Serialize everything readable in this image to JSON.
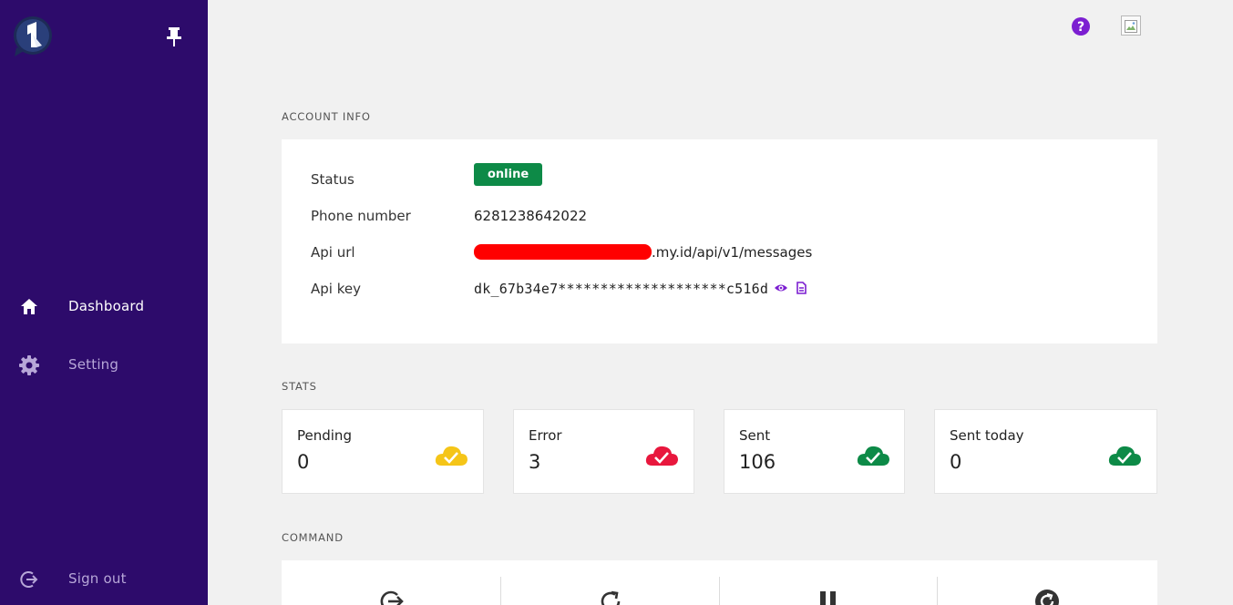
{
  "sidebar": {
    "items": [
      {
        "label": "Dashboard",
        "icon": "home-icon"
      },
      {
        "label": "Setting",
        "icon": "gear-icon"
      }
    ],
    "signout_label": "Sign out",
    "colors": {
      "background": "#2d0b6b",
      "active_text": "#ffffff",
      "inactive_text": "#b7a7d8"
    }
  },
  "header": {
    "help_icon": "help-icon",
    "avatar": "broken-image-icon"
  },
  "sections": {
    "account_info": "ACCOUNT INFO",
    "stats": "STATS",
    "command": "COMMAND"
  },
  "account": {
    "status_label": "Status",
    "status_value": "online",
    "phone_label": "Phone number",
    "phone_value": "6281238642022",
    "api_url_label": "Api url",
    "api_url_suffix": ".my.id/api/v1/messages",
    "api_key_label": "Api key",
    "api_key_value": "dk_67b34e7********************c516d"
  },
  "stats": [
    {
      "label": "Pending",
      "value": "0",
      "color": "#f5c518"
    },
    {
      "label": "Error",
      "value": "3",
      "color": "#e8173d"
    },
    {
      "label": "Sent",
      "value": "106",
      "color": "#0d8a47"
    },
    {
      "label": "Sent today",
      "value": "0",
      "color": "#0d8a47"
    }
  ],
  "commands": [
    "logout-icon",
    "restart-icon",
    "pause-icon",
    "reconnect-icon"
  ],
  "colors": {
    "accent": "#7c1fd1",
    "success": "#0d8a47"
  }
}
